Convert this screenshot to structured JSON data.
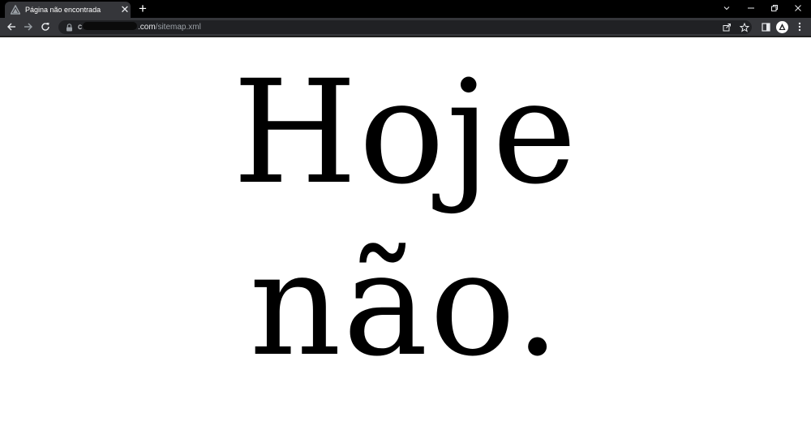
{
  "tab": {
    "title": "Página não encontrada",
    "favicon": "triangle-logo-icon",
    "close_icon": "close-icon",
    "new_tab_icon": "plus-icon"
  },
  "window_controls": [
    "chevron-down-icon",
    "minimize-icon",
    "restore-icon",
    "close-icon"
  ],
  "toolbar": {
    "back_icon": "arrow-left-icon",
    "forward_icon": "arrow-right-icon",
    "reload_icon": "reload-icon",
    "lock_icon": "lock-icon",
    "url_host_visible": "c",
    "url_domain_tail": ".com",
    "url_path": "/sitemap.xml",
    "share_icon": "share-icon",
    "bookmark_icon": "star-icon",
    "side_panel_icon": "side-panel-icon",
    "profile_icon": "triangle-profile-icon",
    "menu_icon": "kebab-menu-icon"
  },
  "content": {
    "line1": "Hoje",
    "line2": "não."
  },
  "colors": {
    "tabstrip": "#000000",
    "active_tab": "#35363a",
    "toolbar": "#35363a",
    "omnibox": "#202124",
    "page_background": "#ffffff",
    "text": "#000000"
  }
}
